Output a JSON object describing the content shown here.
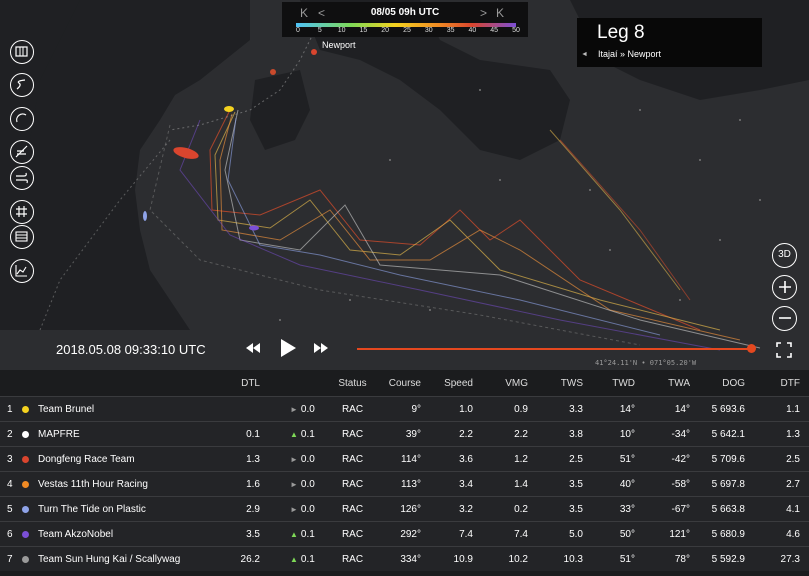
{
  "timeline": {
    "date": "08/05 09h UTC",
    "nav_first": "K",
    "nav_prev": "<",
    "nav_next": ">",
    "nav_last": "K",
    "ticks": [
      "0",
      "5",
      "10",
      "15",
      "20",
      "25",
      "30",
      "35",
      "40",
      "45",
      "50"
    ]
  },
  "leg": {
    "title": "Leg 8",
    "route": "Itajaí » Newport",
    "arrow": "◄"
  },
  "map": {
    "city_label": "Newport",
    "coordinates": "41°24.11'N • 071°05.20'W"
  },
  "right_controls": {
    "three_d": "3D"
  },
  "playback": {
    "datetime": "2018.05.08 09:33:10 UTC",
    "progress": 1.0
  },
  "table": {
    "headers": {
      "dtl": "DTL",
      "status": "Status",
      "course": "Course",
      "speed": "Speed",
      "vmg": "VMG",
      "tws": "TWS",
      "twd": "TWD",
      "twa": "TWA",
      "dog": "DOG",
      "dtf": "DTF"
    },
    "rows": [
      {
        "rank": "1",
        "color": "#f4d21f",
        "team": "Team Brunel",
        "dtl": "",
        "trend": "►",
        "trend_color": "#9a9a9a",
        "delta": "0.0",
        "status": "RAC",
        "course": "9°",
        "speed": "1.0",
        "vmg": "0.9",
        "tws": "3.3",
        "twd": "14°",
        "twa": "14°",
        "dog": "5 693.6",
        "dtf": "1.1"
      },
      {
        "rank": "2",
        "color": "#ffffff",
        "team": "MAPFRE",
        "dtl": "0.1",
        "trend": "▲",
        "trend_color": "#7ed957",
        "delta": "0.1",
        "status": "RAC",
        "course": "39°",
        "speed": "2.2",
        "vmg": "2.2",
        "tws": "3.8",
        "twd": "10°",
        "twa": "-34°",
        "dog": "5 642.1",
        "dtf": "1.3"
      },
      {
        "rank": "3",
        "color": "#d9452e",
        "team": "Dongfeng Race Team",
        "dtl": "1.3",
        "trend": "►",
        "trend_color": "#9a9a9a",
        "delta": "0.0",
        "status": "RAC",
        "course": "114°",
        "speed": "3.6",
        "vmg": "1.2",
        "tws": "2.5",
        "twd": "51°",
        "twa": "-42°",
        "dog": "5 709.6",
        "dtf": "2.5"
      },
      {
        "rank": "4",
        "color": "#f08a24",
        "team": "Vestas 11th Hour Racing",
        "dtl": "1.6",
        "trend": "►",
        "trend_color": "#9a9a9a",
        "delta": "0.0",
        "status": "RAC",
        "course": "113°",
        "speed": "3.4",
        "vmg": "1.4",
        "tws": "3.5",
        "twd": "40°",
        "twa": "-58°",
        "dog": "5 697.8",
        "dtf": "2.7"
      },
      {
        "rank": "5",
        "color": "#8fa3e8",
        "team": "Turn The Tide on Plastic",
        "dtl": "2.9",
        "trend": "►",
        "trend_color": "#9a9a9a",
        "delta": "0.0",
        "status": "RAC",
        "course": "126°",
        "speed": "3.2",
        "vmg": "0.2",
        "tws": "3.5",
        "twd": "33°",
        "twa": "-67°",
        "dog": "5 663.8",
        "dtf": "4.1"
      },
      {
        "rank": "6",
        "color": "#7b4fd6",
        "team": "Team AkzoNobel",
        "dtl": "3.5",
        "trend": "▲",
        "trend_color": "#7ed957",
        "delta": "0.1",
        "status": "RAC",
        "course": "292°",
        "speed": "7.4",
        "vmg": "7.4",
        "tws": "5.0",
        "twd": "50°",
        "twa": "121°",
        "dog": "5 680.9",
        "dtf": "4.6"
      },
      {
        "rank": "7",
        "color": "#9a9a9a",
        "team": "Team Sun Hung Kai / Scallywag",
        "dtl": "26.2",
        "trend": "▲",
        "trend_color": "#7ed957",
        "delta": "0.1",
        "status": "RAC",
        "course": "334°",
        "speed": "10.9",
        "vmg": "10.2",
        "tws": "10.3",
        "twd": "51°",
        "twa": "78°",
        "dog": "5 592.9",
        "dtf": "27.3"
      }
    ]
  }
}
